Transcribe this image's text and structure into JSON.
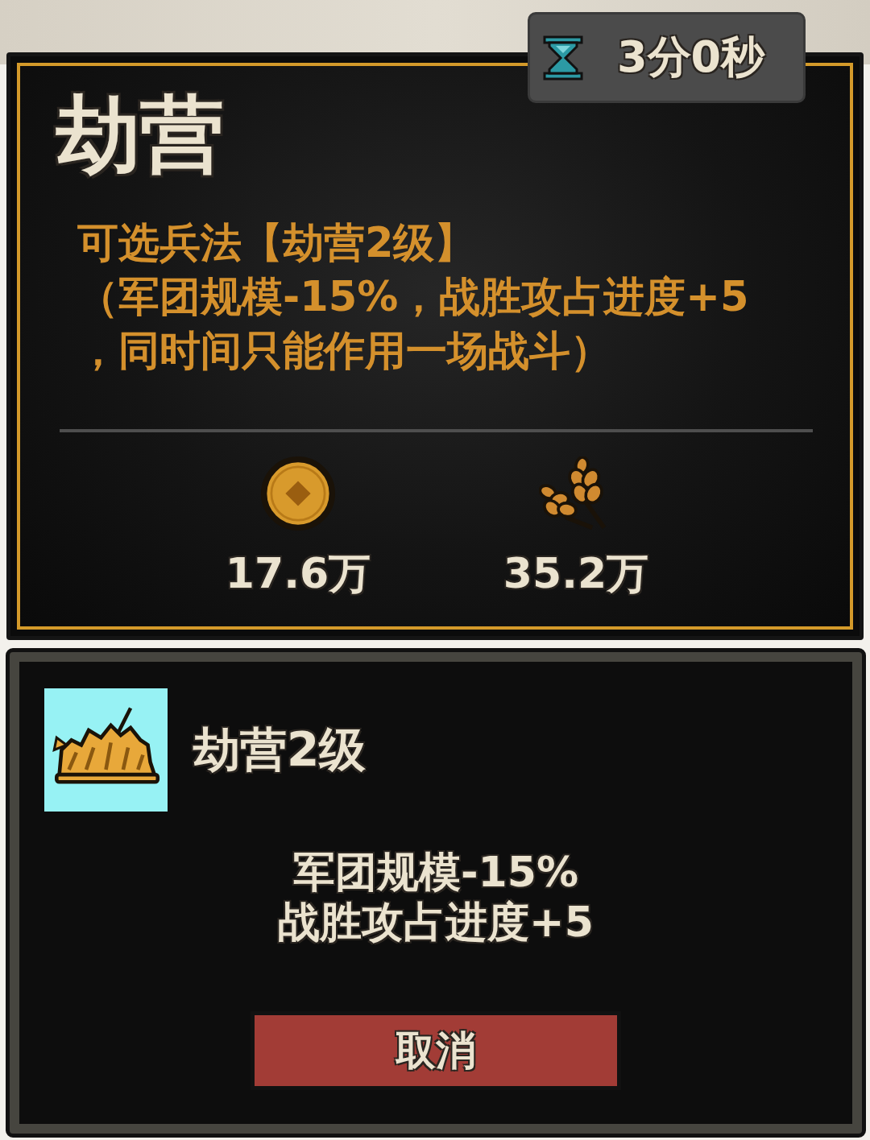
{
  "timer": {
    "text": "3分0秒"
  },
  "panel": {
    "title": "劫营",
    "description_lines": [
      "可选兵法【劫营2级】",
      "（军团规模-15%，战胜攻占进度+5",
      "，同时间只能作用一场战斗）"
    ],
    "costs": [
      {
        "kind": "coin",
        "amount": "17.6万"
      },
      {
        "kind": "grain",
        "amount": "35.2万"
      }
    ]
  },
  "tactic": {
    "name": "劫营2级",
    "effects": [
      "军团规模-15%",
      "战胜攻占进度+5"
    ],
    "button": "取消"
  }
}
